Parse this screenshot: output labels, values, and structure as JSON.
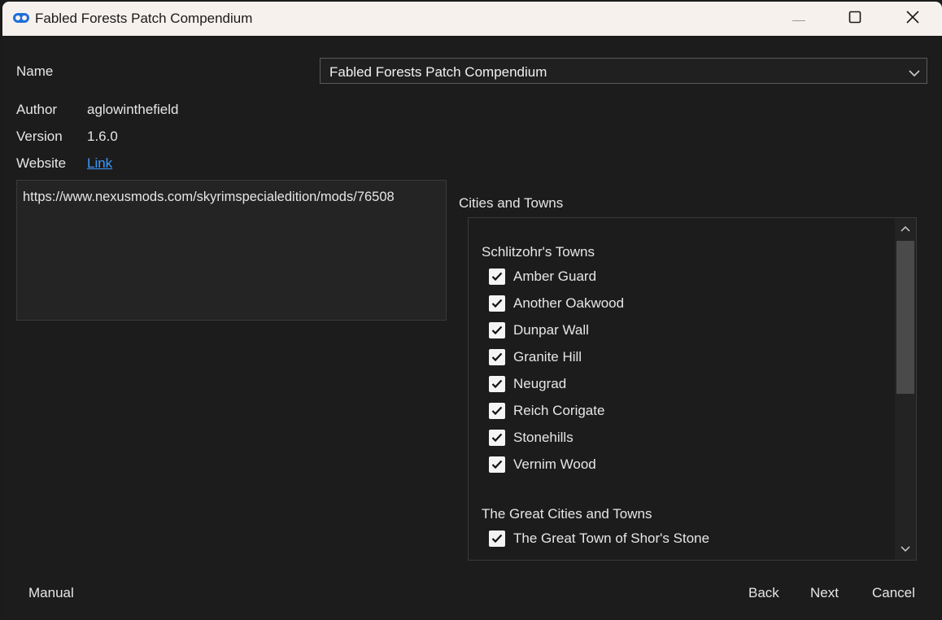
{
  "window": {
    "title": "Fabled Forests Patch Compendium",
    "icon": "app-icon",
    "controls": [
      "minimize-icon",
      "maximize-icon",
      "close-icon"
    ]
  },
  "info": {
    "name_label": "Name",
    "name_value": "Fabled Forests Patch Compendium",
    "author_label": "Author",
    "author_value": "aglowinthefield",
    "version_label": "Version",
    "version_value": "1.6.0",
    "website_label": "Website",
    "website_link_text": "Link",
    "description": "https://www.nexusmods.com/skyrimspecialedition/mods/76508"
  },
  "options": {
    "group_title": "Cities and Towns",
    "sections": [
      {
        "title": "Schlitzohr's Towns",
        "items": [
          {
            "label": "Amber Guard",
            "checked": true
          },
          {
            "label": "Another Oakwood",
            "checked": true
          },
          {
            "label": "Dunpar Wall",
            "checked": true
          },
          {
            "label": "Granite Hill",
            "checked": true
          },
          {
            "label": "Neugrad",
            "checked": true
          },
          {
            "label": "Reich Corigate",
            "checked": true
          },
          {
            "label": "Stonehills",
            "checked": true
          },
          {
            "label": "Vernim Wood",
            "checked": true
          }
        ]
      },
      {
        "title": "The Great Cities and Towns",
        "items": [
          {
            "label": "The Great Town of Shor's Stone",
            "checked": true
          }
        ]
      }
    ]
  },
  "footer": {
    "manual": "Manual",
    "back": "Back",
    "next": "Next",
    "cancel": "Cancel"
  },
  "colors": {
    "titlebar": "#f7f1ee",
    "background": "#1c1c1c",
    "link": "#3a9bff",
    "app_icon": "#1e6fd9"
  }
}
